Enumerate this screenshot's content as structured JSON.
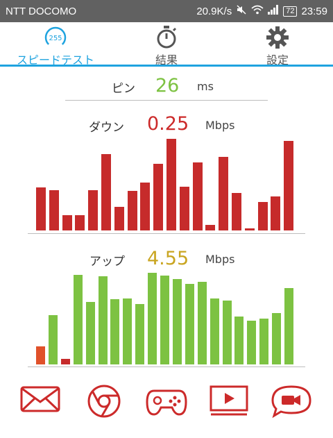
{
  "status_bar": {
    "carrier": "NTT DOCOMO",
    "speed": "20.9K/s",
    "battery": "72",
    "time": "23:59"
  },
  "tabs": [
    {
      "label": "スピードテスト",
      "icon": "speedometer-icon",
      "icon_text": "255",
      "active": true
    },
    {
      "label": "結果",
      "icon": "stopwatch-icon",
      "active": false
    },
    {
      "label": "設定",
      "icon": "gear-icon",
      "active": false
    }
  ],
  "ping": {
    "label": "ピン",
    "value": "26",
    "unit": "ms",
    "color": "#7dc242"
  },
  "download": {
    "label": "ダウン",
    "value": "0.25",
    "unit": "Mbps",
    "color": "#cc2a2a"
  },
  "upload": {
    "label": "アップ",
    "value": "4.55",
    "unit": "Mbps",
    "color": "#c9a521"
  },
  "colors": {
    "accent": "#1ea3df",
    "download_bar": "#c62b2b",
    "upload_bar": "#7dc242",
    "upload_bar_low": "#e0512a",
    "icon_red": "#cc2a2a"
  },
  "chart_data": [
    {
      "type": "bar",
      "name": "download",
      "color": "#c62b2b",
      "values": [
        0.47,
        0.44,
        0.17,
        0.17,
        0.44,
        0.83,
        0.26,
        0.43,
        0.52,
        0.73,
        1.0,
        0.48,
        0.74,
        0.06,
        0.8,
        0.41,
        0.02,
        0.31,
        0.37,
        0.98
      ]
    },
    {
      "type": "bar",
      "name": "upload",
      "colors": [
        "#e0512a",
        "#7dc242",
        "#c62b2b",
        "#7dc242",
        "#7dc242",
        "#7dc242",
        "#7dc242",
        "#7dc242",
        "#7dc242",
        "#7dc242",
        "#7dc242",
        "#7dc242",
        "#7dc242",
        "#7dc242",
        "#7dc242",
        "#7dc242",
        "#7dc242",
        "#7dc242",
        "#7dc242",
        "#7dc242",
        "#7dc242",
        "#7dc242"
      ],
      "values": [
        0.2,
        0.54,
        0.06,
        0.98,
        0.68,
        0.96,
        0.71,
        0.72,
        0.66,
        1.0,
        0.97,
        0.93,
        0.88,
        0.9,
        0.72,
        0.7,
        0.52,
        0.48,
        0.5,
        0.56,
        0.83
      ]
    }
  ],
  "apps": [
    {
      "icon": "mail-icon"
    },
    {
      "icon": "browser-icon"
    },
    {
      "icon": "gamepad-icon"
    },
    {
      "icon": "video-player-icon"
    },
    {
      "icon": "video-chat-icon"
    }
  ]
}
